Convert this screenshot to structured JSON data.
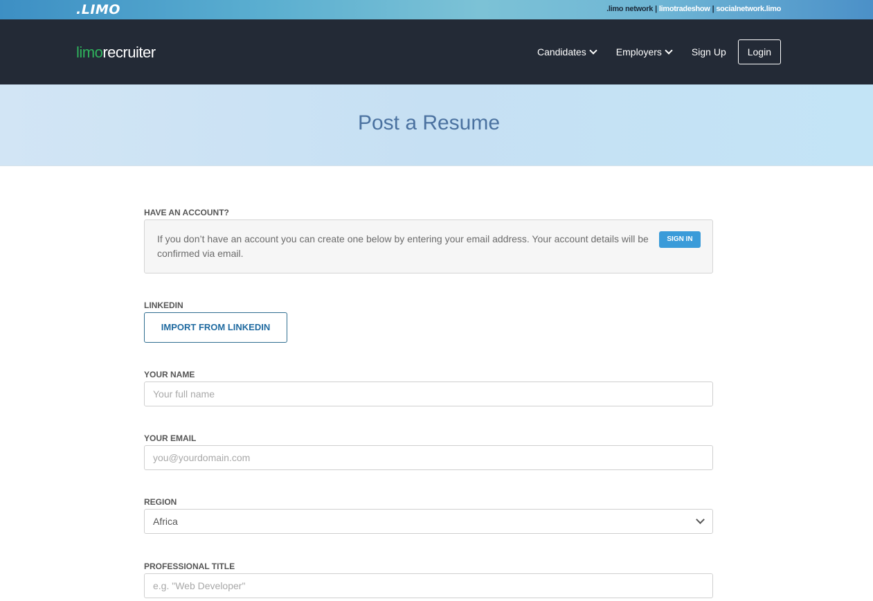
{
  "network_bar": {
    "brand": ".LIMO",
    "links": [
      ".limo network",
      "limotradeshow",
      "socialnetwork.limo"
    ],
    "separator": "|"
  },
  "nav": {
    "logo_part1": "limo",
    "logo_part2": "recruiter",
    "items": [
      "Candidates",
      "Employers",
      "Sign Up"
    ],
    "login": "Login"
  },
  "hero": {
    "title": "Post a Resume"
  },
  "form": {
    "account": {
      "label": "HAVE AN ACCOUNT?",
      "message": "If you don’t have an account you can create one below by entering your email address. Your account details will be confirmed via email.",
      "signin": "SIGN IN"
    },
    "linkedin": {
      "label": "LINKEDIN",
      "button": "IMPORT FROM LINKEDIN"
    },
    "name": {
      "label": "YOUR NAME",
      "placeholder": "Your full name",
      "value": ""
    },
    "email": {
      "label": "YOUR EMAIL",
      "placeholder": "you@yourdomain.com",
      "value": ""
    },
    "region": {
      "label": "REGION",
      "selected": "Africa"
    },
    "title": {
      "label": "PROFESSIONAL TITLE",
      "placeholder": "e.g. \"Web Developer\"",
      "value": ""
    }
  },
  "colors": {
    "nav_bg": "#232a36",
    "logo_green": "#2fb25c",
    "hero_title": "#4b72a0",
    "signin_bg": "#3a9bd9",
    "linkedin_text": "#1f6aa0"
  }
}
